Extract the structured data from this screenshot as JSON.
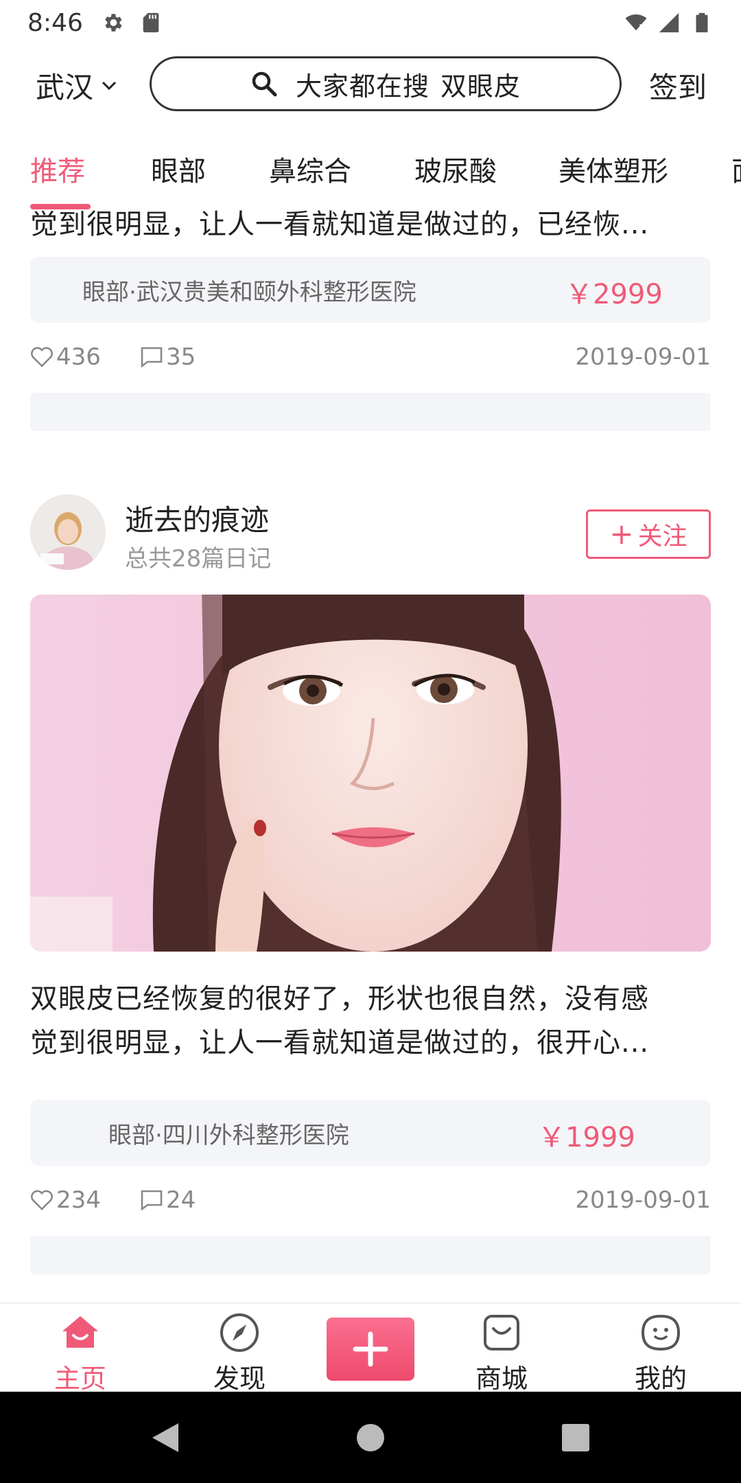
{
  "status_bar": {
    "time": "8:46",
    "left_icons": [
      "gear-icon",
      "sd-card-icon"
    ],
    "right_icons": [
      "wifi-icon",
      "signal-icon",
      "battery-icon"
    ]
  },
  "header": {
    "city": "武汉",
    "search_prefix": "大家都在搜",
    "search_keyword": "双眼皮",
    "checkin_label": "签到"
  },
  "tabs": {
    "items": [
      "推荐",
      "眼部",
      "鼻综合",
      "玻尿酸",
      "美体塑形",
      "面"
    ],
    "active_index": 0
  },
  "posts": [
    {
      "text_line2": "觉到很明显，让人一看就知道是做过的，已经恢...",
      "hospital": "眼部·武汉贵美和颐外科整形医院",
      "price": "￥2999",
      "likes": "436",
      "comments": "35",
      "date": "2019-09-01"
    },
    {
      "user_name": "逝去的痕迹",
      "user_sub": "总共28篇日记",
      "follow_label": "关注",
      "text_line1": "双眼皮已经恢复的很好了，形状也很自然，没有感",
      "text_line2": "觉到很明显，让人一看就知道是做过的，很开心...",
      "hospital": "眼部·四川外科整形医院",
      "price": "￥1999",
      "likes": "234",
      "comments": "24",
      "date": "2019-09-01"
    }
  ],
  "bottom_nav": {
    "items": [
      {
        "label": "主页",
        "icon": "home-icon"
      },
      {
        "label": "发现",
        "icon": "compass-icon"
      },
      {
        "label": "商城",
        "icon": "bag-icon"
      },
      {
        "label": "我的",
        "icon": "face-icon"
      }
    ],
    "active_index": 0,
    "center_icon": "plus-icon"
  },
  "colors": {
    "accent": "#f05a78",
    "card_bg": "#f4f5f8",
    "meta_text": "#888888"
  }
}
